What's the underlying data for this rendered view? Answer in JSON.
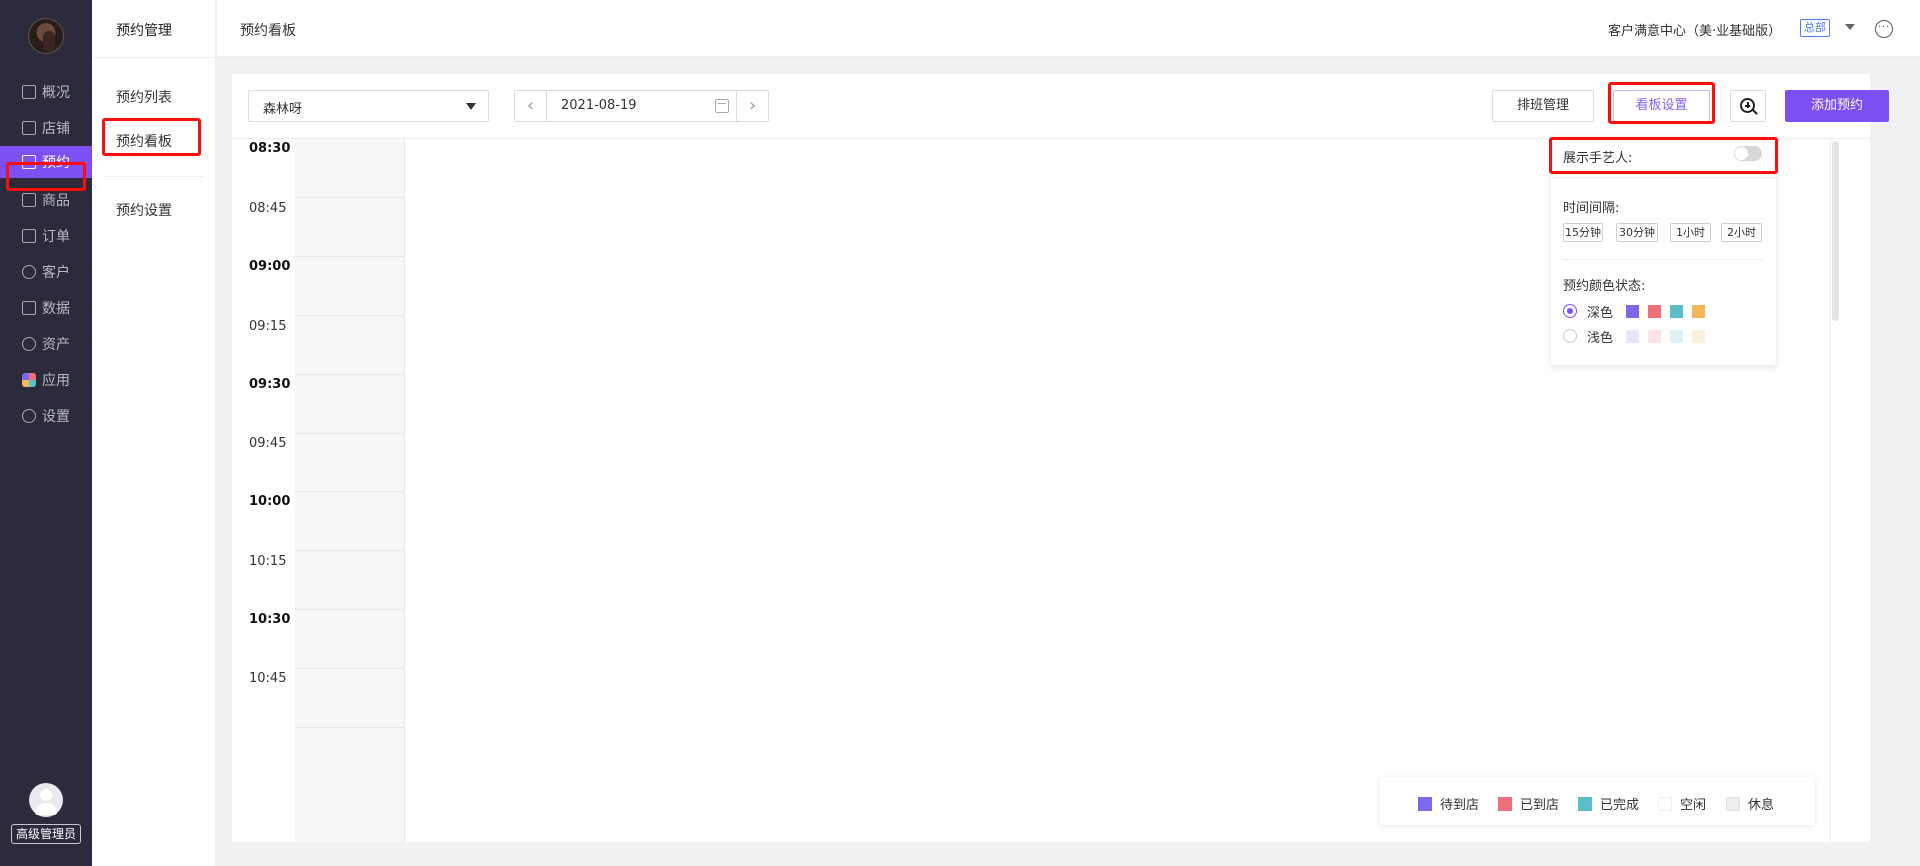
{
  "sidebar": {
    "items": [
      {
        "label": "概况",
        "icon": "monitor-icon"
      },
      {
        "label": "店铺",
        "icon": "store-icon"
      },
      {
        "label": "预约",
        "icon": "calendar-icon",
        "active": true
      },
      {
        "label": "商品",
        "icon": "bag-icon"
      },
      {
        "label": "订单",
        "icon": "document-icon"
      },
      {
        "label": "客户",
        "icon": "user-icon"
      },
      {
        "label": "数据",
        "icon": "bar-chart-icon"
      },
      {
        "label": "资产",
        "icon": "coin-icon"
      },
      {
        "label": "应用",
        "icon": "apps-icon"
      },
      {
        "label": "设置",
        "icon": "gear-icon"
      }
    ],
    "role": "高级管理员",
    "accent": "#7e4ff2"
  },
  "subnav": {
    "title": "预约管理",
    "items": [
      "预约列表",
      "预约看板",
      "预约设置"
    ],
    "active": "预约看板"
  },
  "header": {
    "page_title": "预约看板",
    "store": "客户满意中心（美·业基础版）",
    "badge": "总部"
  },
  "toolbar": {
    "staff_select": "森林呀",
    "date": "2021-08-19",
    "schedule_btn": "排班管理",
    "board_settings_btn": "看板设置",
    "add_btn": "添加预约"
  },
  "times": [
    {
      "label": "08:30",
      "bold": true
    },
    {
      "label": "08:45",
      "bold": false
    },
    {
      "label": "09:00",
      "bold": true
    },
    {
      "label": "09:15",
      "bold": false
    },
    {
      "label": "09:30",
      "bold": true
    },
    {
      "label": "09:45",
      "bold": false
    },
    {
      "label": "10:00",
      "bold": true
    },
    {
      "label": "10:15",
      "bold": false
    },
    {
      "label": "10:30",
      "bold": true
    },
    {
      "label": "10:45",
      "bold": false
    }
  ],
  "settings": {
    "show_artist_label": "展示手艺人:",
    "show_artist_on": false,
    "interval_label": "时间间隔:",
    "intervals": [
      "15分钟",
      "30分钟",
      "1小时",
      "2小时"
    ],
    "color_state_label": "预约颜色状态:",
    "dark_label": "深色",
    "light_label": "浅色",
    "selected": "dark",
    "dark_colors": [
      "#7b68ee",
      "#f0707a",
      "#5bbfc9",
      "#f3b85a"
    ],
    "light_colors": [
      "#e8e4fb",
      "#fde3e5",
      "#dff3f5",
      "#fdefdc"
    ]
  },
  "legend": [
    {
      "label": "待到店",
      "color": "#7b68ee"
    },
    {
      "label": "已到店",
      "color": "#f0707a"
    },
    {
      "label": "已完成",
      "color": "#5bbfc9"
    },
    {
      "label": "空闲",
      "color": "#ffffff"
    },
    {
      "label": "休息",
      "color": "#eeeeee"
    }
  ]
}
